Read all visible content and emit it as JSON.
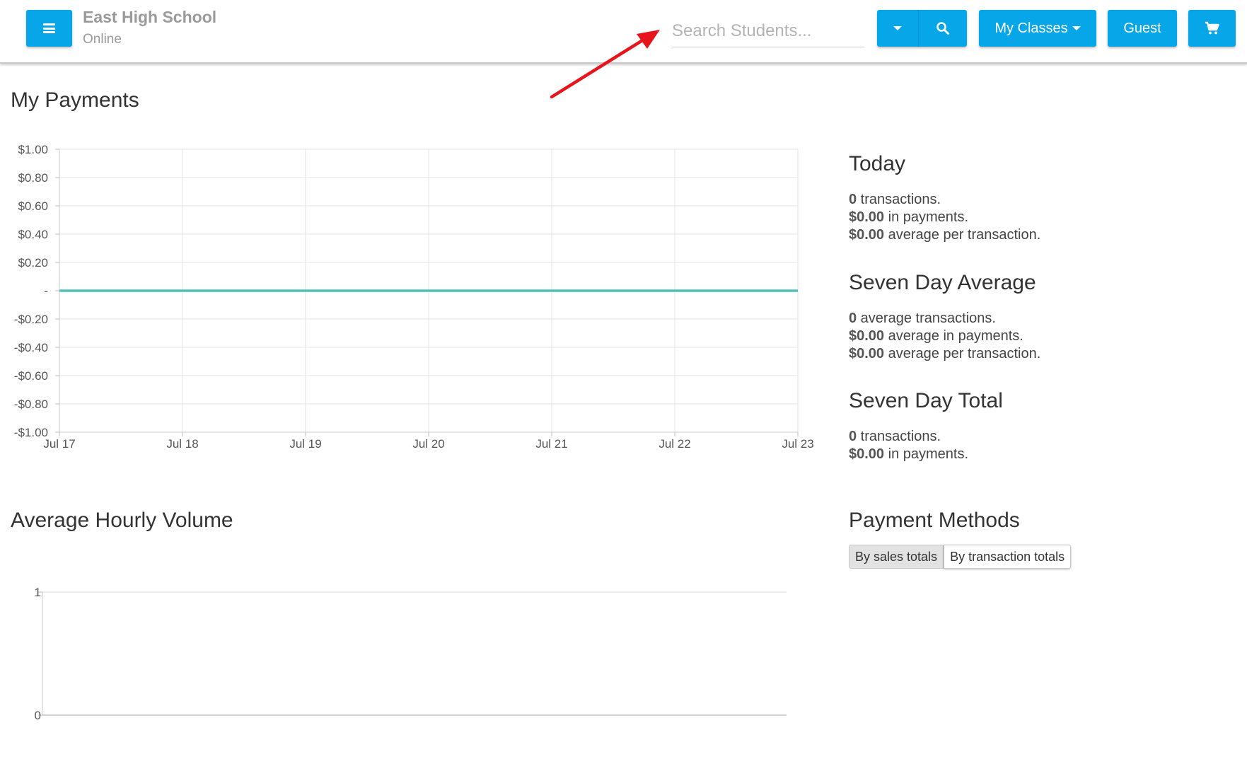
{
  "header": {
    "school_name": "East High School",
    "school_status": "Online",
    "search_placeholder": "Search Students...",
    "my_classes_label": "My Classes",
    "guest_label": "Guest",
    "accent_color": "#06a6e8"
  },
  "payments": {
    "title": "My Payments",
    "chart_data": {
      "type": "line",
      "x": [
        "Jul 17",
        "Jul 18",
        "Jul 19",
        "Jul 20",
        "Jul 21",
        "Jul 22",
        "Jul 23"
      ],
      "y_ticks": [
        "$1.00",
        "$0.80",
        "$0.60",
        "$0.40",
        "$0.20",
        "-",
        "-$0.20",
        "-$0.40",
        "-$0.60",
        "-$0.80",
        "-$1.00"
      ],
      "ylim": [
        -1,
        1
      ],
      "grid": true,
      "series": [
        {
          "values": [
            0,
            0,
            0,
            0,
            0,
            0,
            0
          ],
          "color": "#4ec1b8"
        }
      ]
    }
  },
  "today": {
    "title": "Today",
    "lines": [
      {
        "value": "0",
        "text": " transactions."
      },
      {
        "value": "$0.00",
        "text": " in payments."
      },
      {
        "value": "$0.00",
        "text": " average per transaction."
      }
    ]
  },
  "seven_day_average": {
    "title": "Seven Day Average",
    "lines": [
      {
        "value": "0",
        "text": " average transactions."
      },
      {
        "value": "$0.00",
        "text": " average in payments."
      },
      {
        "value": "$0.00",
        "text": " average per transaction."
      }
    ]
  },
  "seven_day_total": {
    "title": "Seven Day Total",
    "lines": [
      {
        "value": "0",
        "text": " transactions."
      },
      {
        "value": "$0.00",
        "text": " in payments."
      }
    ]
  },
  "hourly": {
    "title": "Average Hourly Volume",
    "chart_data": {
      "type": "bar",
      "y_ticks": [
        "1",
        "0"
      ],
      "ylim": [
        0,
        1
      ],
      "categories": [],
      "values": []
    }
  },
  "payment_methods": {
    "title": "Payment Methods",
    "tabs": [
      "By sales totals",
      "By transaction totals"
    ],
    "active_tab": "By sales totals"
  },
  "annotation": {
    "arrow_color": "#e8141b"
  }
}
